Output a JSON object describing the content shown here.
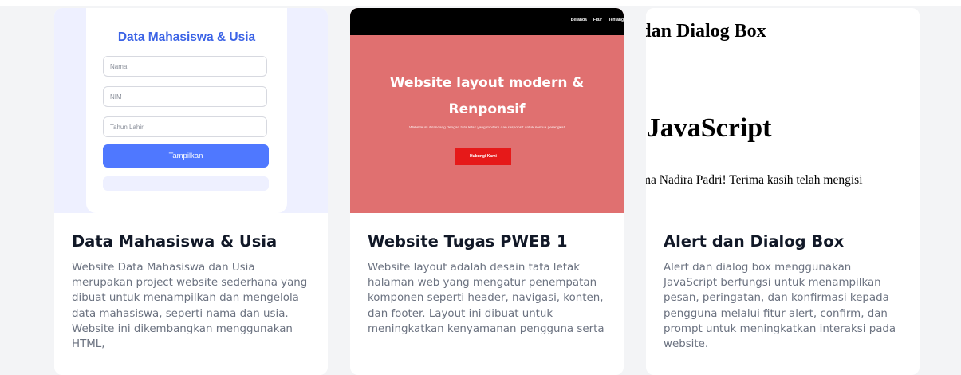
{
  "cards": [
    {
      "title": "Data Mahasiswa & Usia",
      "description": "Website Data Mahasiswa dan Usia merupakan project website sederhana yang dibuat untuk menampilkan dan mengelola data mahasiswa, seperti nama dan usia. Website ini dikembangkan menggunakan HTML,",
      "preview": {
        "heading": "Data Mahasiswa & Usia",
        "inputs": [
          "Nama",
          "NIM",
          "Tahun Lahir"
        ],
        "button_label": "Tampilkan",
        "accent": "#4f78ff"
      }
    },
    {
      "title": "Website Tugas PWEB 1",
      "description": "Website layout adalah desain tata letak halaman web yang mengatur penempatan komponen seperti header, navigasi, konten, dan footer. Layout ini dibuat untuk meningkatkan kenyamanan pengguna serta",
      "preview": {
        "nav_links": [
          "Beranda",
          "Fitur",
          "Tentang"
        ],
        "hero_title": "Website layout modern & Renponsif",
        "hero_subtitle": "Website ini dirancang dengan tata letak yang modern dan responsif untuk semua perangkat",
        "button_label": "Hubungi Kami",
        "background": "#e07070",
        "button_color": "#e61919"
      }
    },
    {
      "title": "Alert dan Dialog Box",
      "description": "Alert dan dialog box menggunakan JavaScript berfungsi untuk menampilkan pesan, peringatan, dan konfirmasi kepada pengguna melalui fitur alert, confirm, dan prompt untuk meningkatkan interaksi pada website.",
      "preview": {
        "line1": "Alert dan Dialog Box",
        "line2": "Interaksi JavaScript",
        "line3": "Halo, Nama Nadira Padri! Terima kasih telah mengisi"
      }
    }
  ]
}
